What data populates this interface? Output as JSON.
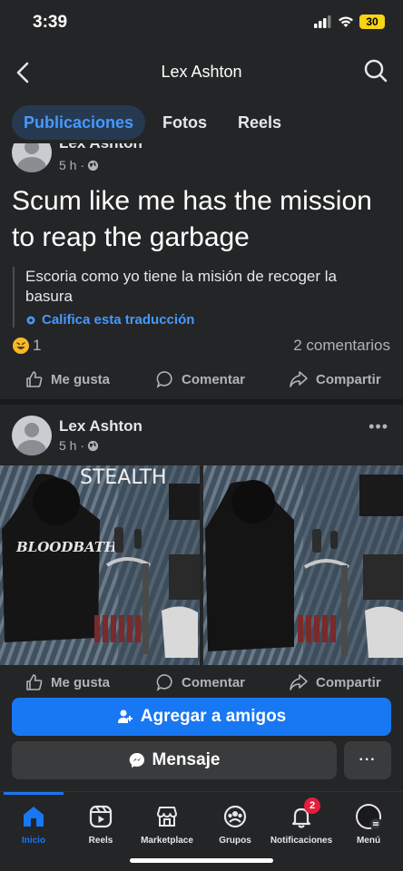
{
  "status_bar": {
    "time": "3:39",
    "battery": "30"
  },
  "nav": {
    "title": "Lex Ashton"
  },
  "tabs": [
    {
      "label": "Publicaciones",
      "active": true
    },
    {
      "label": "Fotos",
      "active": false
    },
    {
      "label": "Reels",
      "active": false
    }
  ],
  "post1": {
    "author": "Lex Ashton",
    "time": "5 h ·",
    "text": "Scum like me has the mission to reap the garbage",
    "translation": "Escoria como yo tiene la misión de recoger la basura",
    "rate_translation": "Califica esta traducción",
    "reaction_count": "1",
    "comments": "2 comentarios",
    "actions": {
      "like": "Me gusta",
      "comment": "Comentar",
      "share": "Compartir"
    }
  },
  "post2": {
    "author": "Lex Ashton",
    "time": "5 h ·",
    "photo_caption_left": "STEALTH",
    "photo_text_left": "BLOODBATH",
    "actions": {
      "like": "Me gusta",
      "comment": "Comentar",
      "share": "Compartir"
    }
  },
  "buttons": {
    "add_friend": "Agregar a amigos",
    "message": "Mensaje",
    "more": "···"
  },
  "tabbar": [
    {
      "label": "Inicio",
      "icon": "home-icon",
      "active": true
    },
    {
      "label": "Reels",
      "icon": "reels-icon",
      "active": false
    },
    {
      "label": "Marketplace",
      "icon": "marketplace-icon",
      "active": false
    },
    {
      "label": "Grupos",
      "icon": "groups-icon",
      "active": false
    },
    {
      "label": "Notificaciones",
      "icon": "bell-icon",
      "active": false,
      "badge": "2"
    },
    {
      "label": "Menú",
      "icon": "menu-avatar-icon",
      "active": false
    }
  ],
  "colors": {
    "accent": "#1877f2",
    "background": "#242526",
    "link": "#4599ff",
    "badge": "#e41e3f"
  }
}
